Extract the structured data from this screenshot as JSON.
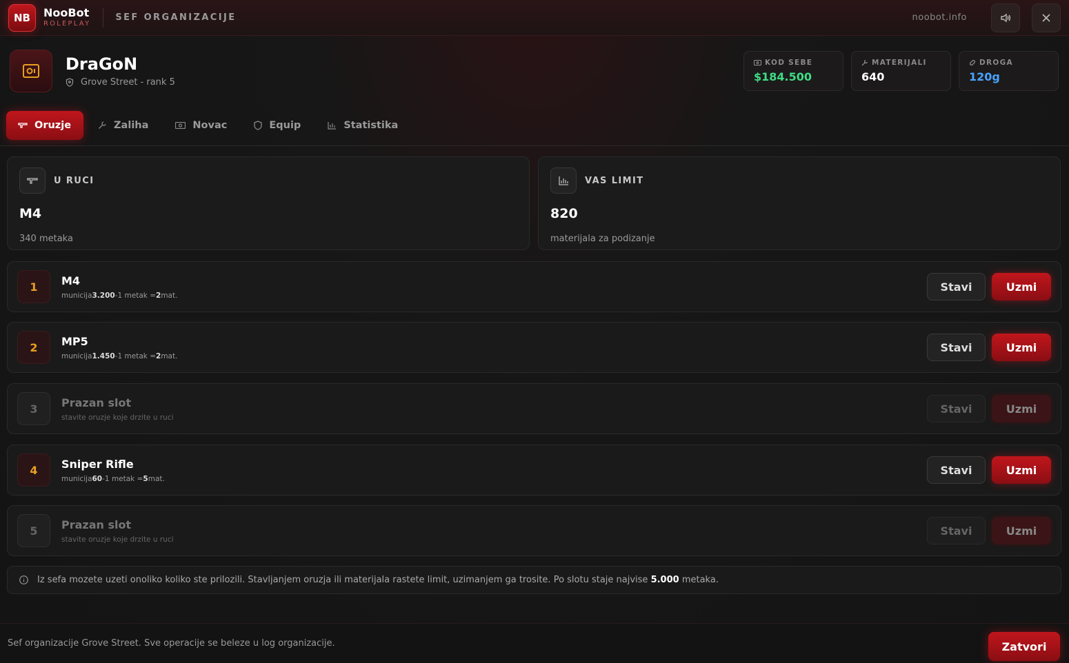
{
  "header": {
    "logo": "NB",
    "brand_name": "NooBot",
    "brand_sub": "ROLEPLAY",
    "title": "SEF ORGANIZACIJE",
    "site": "noobot.info"
  },
  "profile": {
    "name": "DraGoN",
    "subtitle": "Grove Street - rank 5"
  },
  "stats": [
    {
      "label": "KOD SEBE",
      "value": "$184.500",
      "color": "#3ddc84"
    },
    {
      "label": "MATERIJALI",
      "value": "640",
      "color": "#ffffff"
    },
    {
      "label": "DROGA",
      "value": "120g",
      "color": "#4aa3ff"
    }
  ],
  "tabs": [
    {
      "label": "Oruzje",
      "active": true
    },
    {
      "label": "Zaliha",
      "active": false
    },
    {
      "label": "Novac",
      "active": false
    },
    {
      "label": "Equip",
      "active": false
    },
    {
      "label": "Statistika",
      "active": false
    }
  ],
  "in_hand": {
    "title": "U RUCI",
    "value": "M4",
    "sub": "340 metaka"
  },
  "limit": {
    "title": "VAS LIMIT",
    "value": "820",
    "sub": "materijala za podizanje"
  },
  "slots": [
    {
      "num": "1",
      "name": "M4",
      "ammo_label": "municija",
      "ammo": "3.200",
      "sep": "-",
      "rate_label": "1 metak =",
      "rate": "2",
      "unit": "mat.",
      "empty": false
    },
    {
      "num": "2",
      "name": "MP5",
      "ammo_label": "municija",
      "ammo": "1.450",
      "sep": "-",
      "rate_label": "1 metak =",
      "rate": "2",
      "unit": "mat.",
      "empty": false
    },
    {
      "num": "3",
      "name": "Prazan slot",
      "hint": "stavite oruzje koje drzite u ruci",
      "empty": true
    },
    {
      "num": "4",
      "name": "Sniper Rifle",
      "ammo_label": "municija",
      "ammo": "60",
      "sep": "-",
      "rate_label": "1 metak =",
      "rate": "5",
      "unit": "mat.",
      "empty": false
    },
    {
      "num": "5",
      "name": "Prazan slot",
      "hint": "stavite oruzje koje drzite u ruci",
      "empty": true
    }
  ],
  "buttons": {
    "stavi": "Stavi",
    "uzmi": "Uzmi",
    "close": "Zatvori"
  },
  "info": {
    "text_before": "Iz sefa mozete uzeti onoliko koliko ste prilozili. Stavljanjem oruzja ili materijala rastete limit, uzimanjem ga trosite. Po slotu staje najvise ",
    "highlight": "5.000",
    "text_after": " metaka."
  },
  "footer": {
    "text": "Sef organizacije Grove Street. Sve operacije se beleze u log organizacije."
  },
  "colors": {
    "accent": "#c0161c",
    "slot_number": "#e8a020",
    "money": "#3ddc84",
    "drug": "#4aa3ff"
  }
}
